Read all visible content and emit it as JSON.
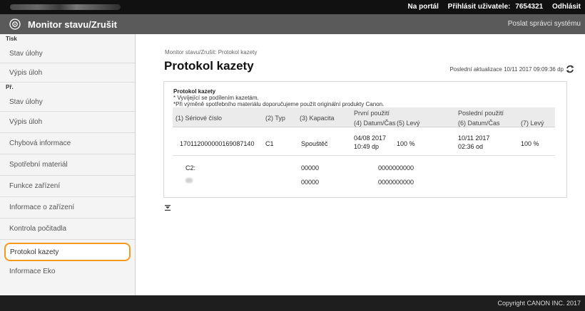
{
  "topbar": {
    "portal_link": "Na portál",
    "login_user": "Přihlásit uživatele:",
    "user_id": "7654321",
    "logout": "Odhlásit"
  },
  "titlebar": {
    "title": "Monitor stavu/Zrušit",
    "send_admin": "Poslat správci systému"
  },
  "sidebar": {
    "groups": [
      {
        "header": "Tisk",
        "items": [
          "Stav úlohy",
          "Výpis úloh"
        ]
      },
      {
        "header": "Př.",
        "items": [
          "Stav úlohy",
          "Výpis úloh"
        ]
      }
    ],
    "items": [
      "Chybová informace",
      "Spotřební materiál",
      "Funkce zařízení",
      "Informace o zařízení",
      "Kontrola počitadla",
      "Protokol kazety",
      "Informace Eko"
    ]
  },
  "main": {
    "breadcrumb": "Monitor stavu/Zrušit: Protokol kazety",
    "title": "Protokol kazety",
    "last_update": "Poslední aktualizace 10/11 2017 09:09:36 dp"
  },
  "panel": {
    "title": "Protokol kazety",
    "note1": "* Vyvíjející se podílením kazetám.",
    "note2": "*Při výměně spotřebního materiálu doporučujeme použít originální produkty Canon.",
    "headers": {
      "serial": "(1) Sériové číslo",
      "type": "(2) Typ",
      "capacity": "(3) Kapacita",
      "first_use": "První použití",
      "date_time_4": "(4) Datum/Čas",
      "remaining_5": "(5) Levý",
      "last_use": "Poslední použití",
      "date_time_6": "(6) Datum/Čas",
      "remaining_7": "(7) Levý"
    },
    "rows": [
      {
        "serial": "170112000000169087140",
        "type": "C1",
        "capacity": "Spouštěč",
        "first_date": "04/08 2017",
        "first_time": "10:49 dp",
        "first_left": "100 %",
        "last_date": "10/11 2017",
        "last_time": "02:36 od",
        "last_left": "100 %"
      },
      {
        "serial": "C2:",
        "capacity": "00000",
        "first_date": "0000000000"
      },
      {
        "capacity": "00000",
        "first_date": "0000000000"
      }
    ]
  },
  "footer": {
    "copyright": "Copyright CANON INC. 2017"
  },
  "colors": {
    "topbar": "#111111",
    "titlebar": "#5a5a5a",
    "active_outline": "#f39a1e",
    "footer": "#1e1e1e"
  },
  "icons": {
    "app": "monitor-status-icon",
    "refresh": "refresh-icon",
    "collapse": "collapse-icon"
  }
}
